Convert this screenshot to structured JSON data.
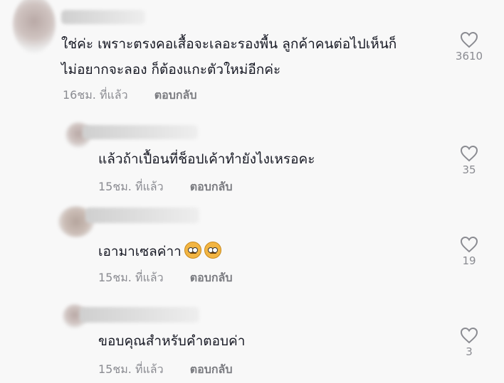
{
  "comments": [
    {
      "text_lines": [
        "ใช่ค่ะ เพราะตรงคอเสื้อจะเลอะรองพื้น ลูกค้าคนต่อไปเห็นก็",
        "ไม่อยากจะลอง ก็ต้องแกะตัวใหม่อีกค่ะ"
      ],
      "time": "16ชม. ที่แล้ว",
      "reply": "ตอบกลับ",
      "likes": "3610"
    },
    {
      "text_lines": [
        "แล้วถ้าเปื้อนที่ช็อปเค้าทำยังไงเหรอคะ"
      ],
      "time": "15ชม. ที่แล้ว",
      "reply": "ตอบกลับ",
      "likes": "35"
    },
    {
      "text_lines": [
        "เอามาเซลค่าา"
      ],
      "emoji": "rolling-eyes-emoji",
      "time": "15ชม. ที่แล้ว",
      "reply": "ตอบกลับ",
      "likes": "19"
    },
    {
      "text_lines": [
        "ขอบคุณสำหรับคำตอบค่า"
      ],
      "time": "15ชม. ที่แล้ว",
      "reply": "ตอบกลับ",
      "likes": "3"
    }
  ],
  "icons": {
    "like": "heart-outline-icon"
  },
  "colors": {
    "background": "#f8f8f8",
    "text": "#161823",
    "meta": "#8a8b91"
  }
}
